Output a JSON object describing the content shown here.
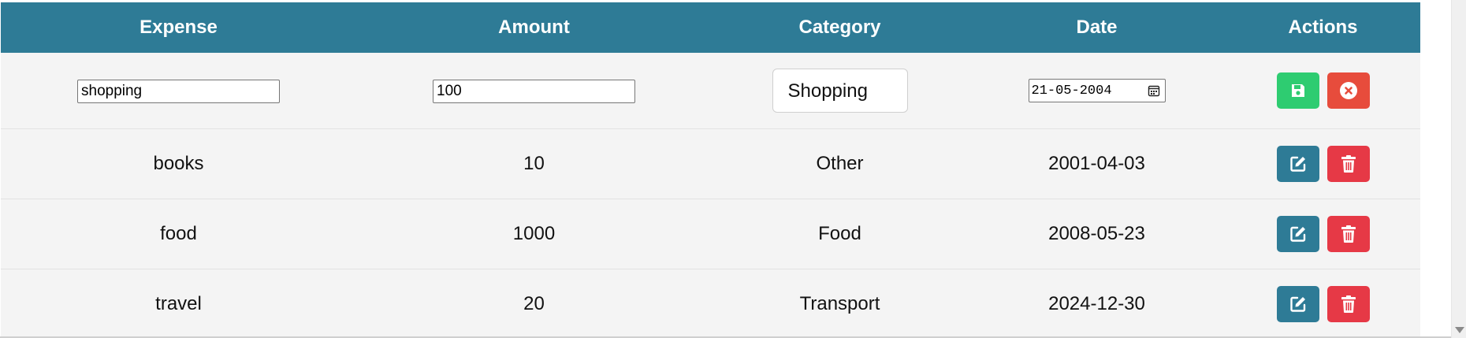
{
  "table": {
    "headers": [
      "Expense",
      "Amount",
      "Category",
      "Date",
      "Actions"
    ],
    "edit_row": {
      "expense_value": "shopping",
      "amount_value": "100",
      "category_value": "Shopping",
      "date_value": "21-05-2004"
    },
    "rows": [
      {
        "expense": "books",
        "amount": "10",
        "category": "Other",
        "date": "2001-04-03"
      },
      {
        "expense": "food",
        "amount": "1000",
        "category": "Food",
        "date": "2008-05-23"
      },
      {
        "expense": "travel",
        "amount": "20",
        "category": "Transport",
        "date": "2024-12-30"
      }
    ]
  },
  "colors": {
    "header_bg": "#2e7b96",
    "save": "#2ecc71",
    "cancel": "#e74c3c",
    "edit": "#2e7b96",
    "delete": "#e63946"
  },
  "icons": {
    "save": "floppy-disk-icon",
    "cancel": "circle-x-icon",
    "edit": "pen-square-icon",
    "delete": "trash-icon",
    "calendar": "calendar-icon"
  }
}
